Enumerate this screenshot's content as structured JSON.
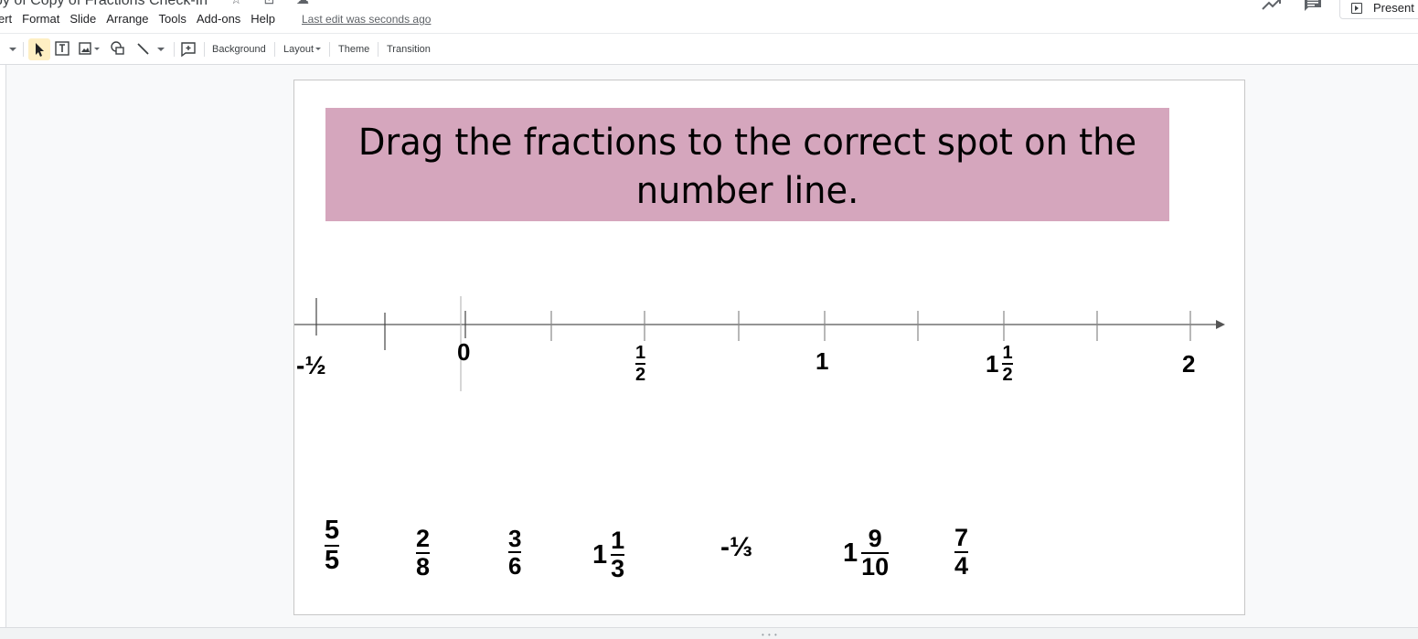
{
  "window": {
    "doc_title": "py of Copy of Fractions Check-In",
    "title_icons": "☆ ⊡ ☁",
    "last_edit": "Last edit was seconds ago",
    "present_label": "Present"
  },
  "menu": [
    "ert",
    "Format",
    "Slide",
    "Arrange",
    "Tools",
    "Add-ons",
    "Help"
  ],
  "toolbar": {
    "background_label": "Background",
    "layout_label": "Layout",
    "theme_label": "Theme",
    "transition_label": "Transition",
    "icons": [
      "dropdown-arrow-icon",
      "select-arrow-icon",
      "text-box-icon",
      "image-icon",
      "shape-icon",
      "line-icon",
      "add-comment-icon"
    ]
  },
  "slide": {
    "instruction": "Drag the fractions to the correct spot on the number line.",
    "banner_color": "#d5a6bd",
    "number_line": {
      "labels": {
        "neg_half": "-½",
        "zero": "0",
        "half_num": "1",
        "half_den": "2",
        "one": "1",
        "one_half_whole": "1",
        "one_half_num": "1",
        "one_half_den": "2",
        "two": "2"
      }
    },
    "draggable_fractions": [
      {
        "whole": "",
        "num": "5",
        "den": "5"
      },
      {
        "whole": "",
        "num": "2",
        "den": "8"
      },
      {
        "whole": "",
        "num": "3",
        "den": "6"
      },
      {
        "whole": "1",
        "num": "1",
        "den": "3"
      },
      {
        "text": "-⅓"
      },
      {
        "whole": "1",
        "num": "9",
        "den": "10"
      },
      {
        "whole": "",
        "num": "7",
        "den": "4"
      }
    ]
  }
}
